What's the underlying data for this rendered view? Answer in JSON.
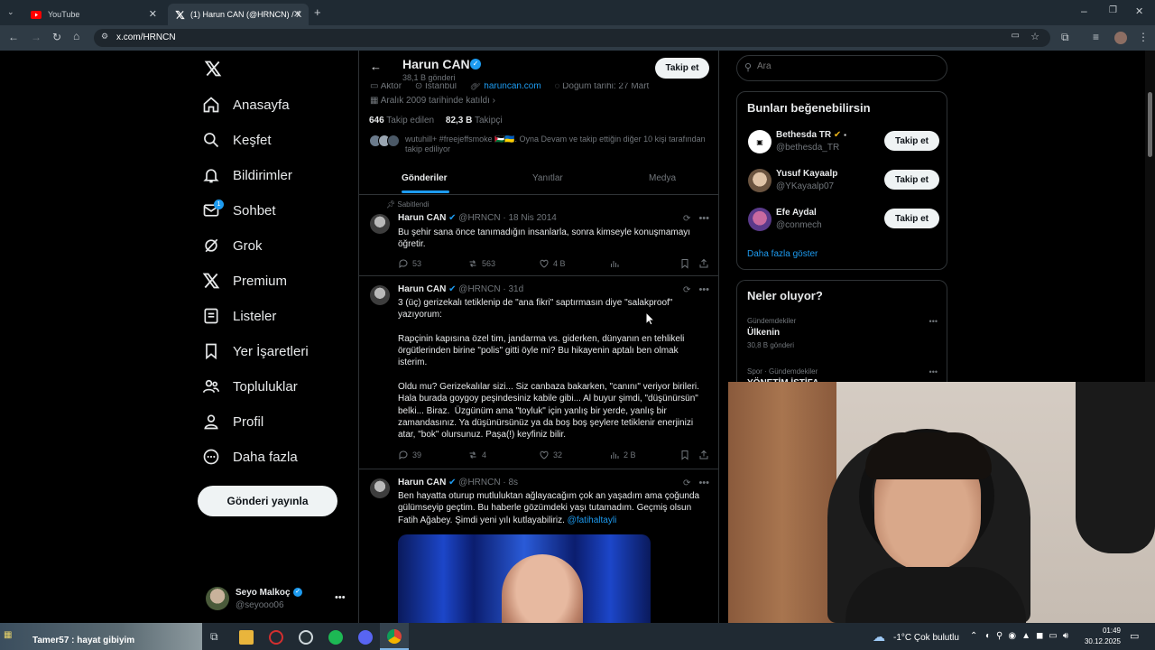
{
  "browser": {
    "tabs": [
      {
        "title": "YouTube",
        "icon": "youtube-icon",
        "active": false
      },
      {
        "title": "(1) Harun CAN (@HRNCN) / X",
        "icon": "x-logo-icon",
        "active": true
      }
    ],
    "url": "x.com/HRNCN"
  },
  "nav": {
    "items": [
      {
        "label": "Anasayfa",
        "icon": "home-icon"
      },
      {
        "label": "Keşfet",
        "icon": "search-icon"
      },
      {
        "label": "Bildirimler",
        "icon": "bell-icon"
      },
      {
        "label": "Sohbet",
        "icon": "mail-icon",
        "badge": "1"
      },
      {
        "label": "Grok",
        "icon": "grok-icon"
      },
      {
        "label": "Premium",
        "icon": "x-logo-icon"
      },
      {
        "label": "Listeler",
        "icon": "list-icon"
      },
      {
        "label": "Yer İşaretleri",
        "icon": "bookmark-icon"
      },
      {
        "label": "Topluluklar",
        "icon": "community-icon"
      },
      {
        "label": "Profil",
        "icon": "person-icon"
      },
      {
        "label": "Daha fazla",
        "icon": "more-circle-icon"
      }
    ],
    "post_button": "Gönderi yayınla",
    "account": {
      "name": "Seyo Malkoç",
      "handle": "@seyooo06"
    }
  },
  "profile": {
    "name": "Harun CAN",
    "post_count": "38,1 B gönderi",
    "follow_button": "Takip et",
    "meta": {
      "job": "Aktör",
      "location": "İstanbul",
      "website": "haruncan.com",
      "birth": "Doğum tarihi: 27 Mart",
      "joined": "Aralık 2009 tarihinde katıldı"
    },
    "following_num": "646",
    "following_label": "Takip edilen",
    "followers_num": "82,3 B",
    "followers_label": "Takipçi",
    "followed_by": "wutuhill+ #freejeffsmoke 🇵🇸🇺🇦. Oyna Devam ve takip ettiğin diğer 10 kişi tarafından takip ediliyor",
    "tabs": [
      "Gönderiler",
      "Yanıtlar",
      "Medya"
    ]
  },
  "tweets": [
    {
      "pinned": "Sabitlendi",
      "name": "Harun CAN",
      "handle": "@HRNCN",
      "time": "· 18 Nis 2014",
      "text": "Bu şehir sana önce tanımadığın insanlarla, sonra kimseyle konuşmamayı öğretir.",
      "replies": "53",
      "retweets": "563",
      "likes": "4 B",
      "views": ""
    },
    {
      "name": "Harun CAN",
      "handle": "@HRNCN",
      "time": "· 31d",
      "text": "3 (üç) gerizekalı tetiklenip de \"ana fikri\" saptırmasın diye \"salakproof\" yazıyorum:\n\nRapçinin kapısına özel tim, jandarma vs. giderken, dünyanın en tehlikeli örgütlerinden birine \"polis\" gitti öyle mi? Bu hikayenin aptalı ben olmak isterim.\n\nOldu mu? Gerizekalılar sizi... Siz canbaza bakarken, \"canını\" veriyor birileri. Hala burada goygoy peşindesiniz kabile gibi... Al buyur şimdi, \"düşünürsün\" belki... Biraz.  Üzgünüm ama \"toyluk\" için yanlış bir yerde, yanlış bir zamandasınız. Ya düşünürsünüz ya da boş boş şeylere tetiklenir enerjinizi atar, \"bok\" olursunuz. Paşa(!) keyfiniz bilir.",
      "replies": "39",
      "retweets": "4",
      "likes": "32",
      "views": "2 B"
    },
    {
      "name": "Harun CAN",
      "handle": "@HRNCN",
      "time": "· 8s",
      "text": "Ben hayatta oturup mutluluktan ağlayacağım çok an yaşadım ama çoğunda gülümseyip geçtim. Bu haberle gözümdeki yaşı tutamadım. Geçmiş olsun Fatih Ağabey. Şimdi yeni yılı kutlayabiliriz. ",
      "mention": "@fatihaltayli"
    }
  ],
  "search": {
    "placeholder": "Ara"
  },
  "suggestions": {
    "title": "Bunları beğenebilirsin",
    "users": [
      {
        "name": "Bethesda TR",
        "handle": "@bethesda_TR",
        "button": "Takip et"
      },
      {
        "name": "Yusuf Kayaalp",
        "handle": "@YKayaalp07",
        "button": "Takip et"
      },
      {
        "name": "Efe Aydal",
        "handle": "@conmech",
        "button": "Takip et"
      }
    ],
    "more": "Daha fazla göster"
  },
  "trends": {
    "title": "Neler oluyor?",
    "items": [
      {
        "context": "Gündemdekiler",
        "name": "Ülkenin",
        "count": "30,8 B gönderi"
      },
      {
        "context": "Spor · Gündemdekiler",
        "name": "YÖNETİM İSTİFA",
        "count": ""
      }
    ]
  },
  "taskbar": {
    "now_playing": "Tamer57 : hayat gibiyim",
    "weather": "-1°C  Çok bulutlu",
    "time": "01:49",
    "date": "30.12.2025"
  },
  "colors": {
    "accent": "#1d9bf0",
    "background": "#000000",
    "border": "#2f3336"
  }
}
